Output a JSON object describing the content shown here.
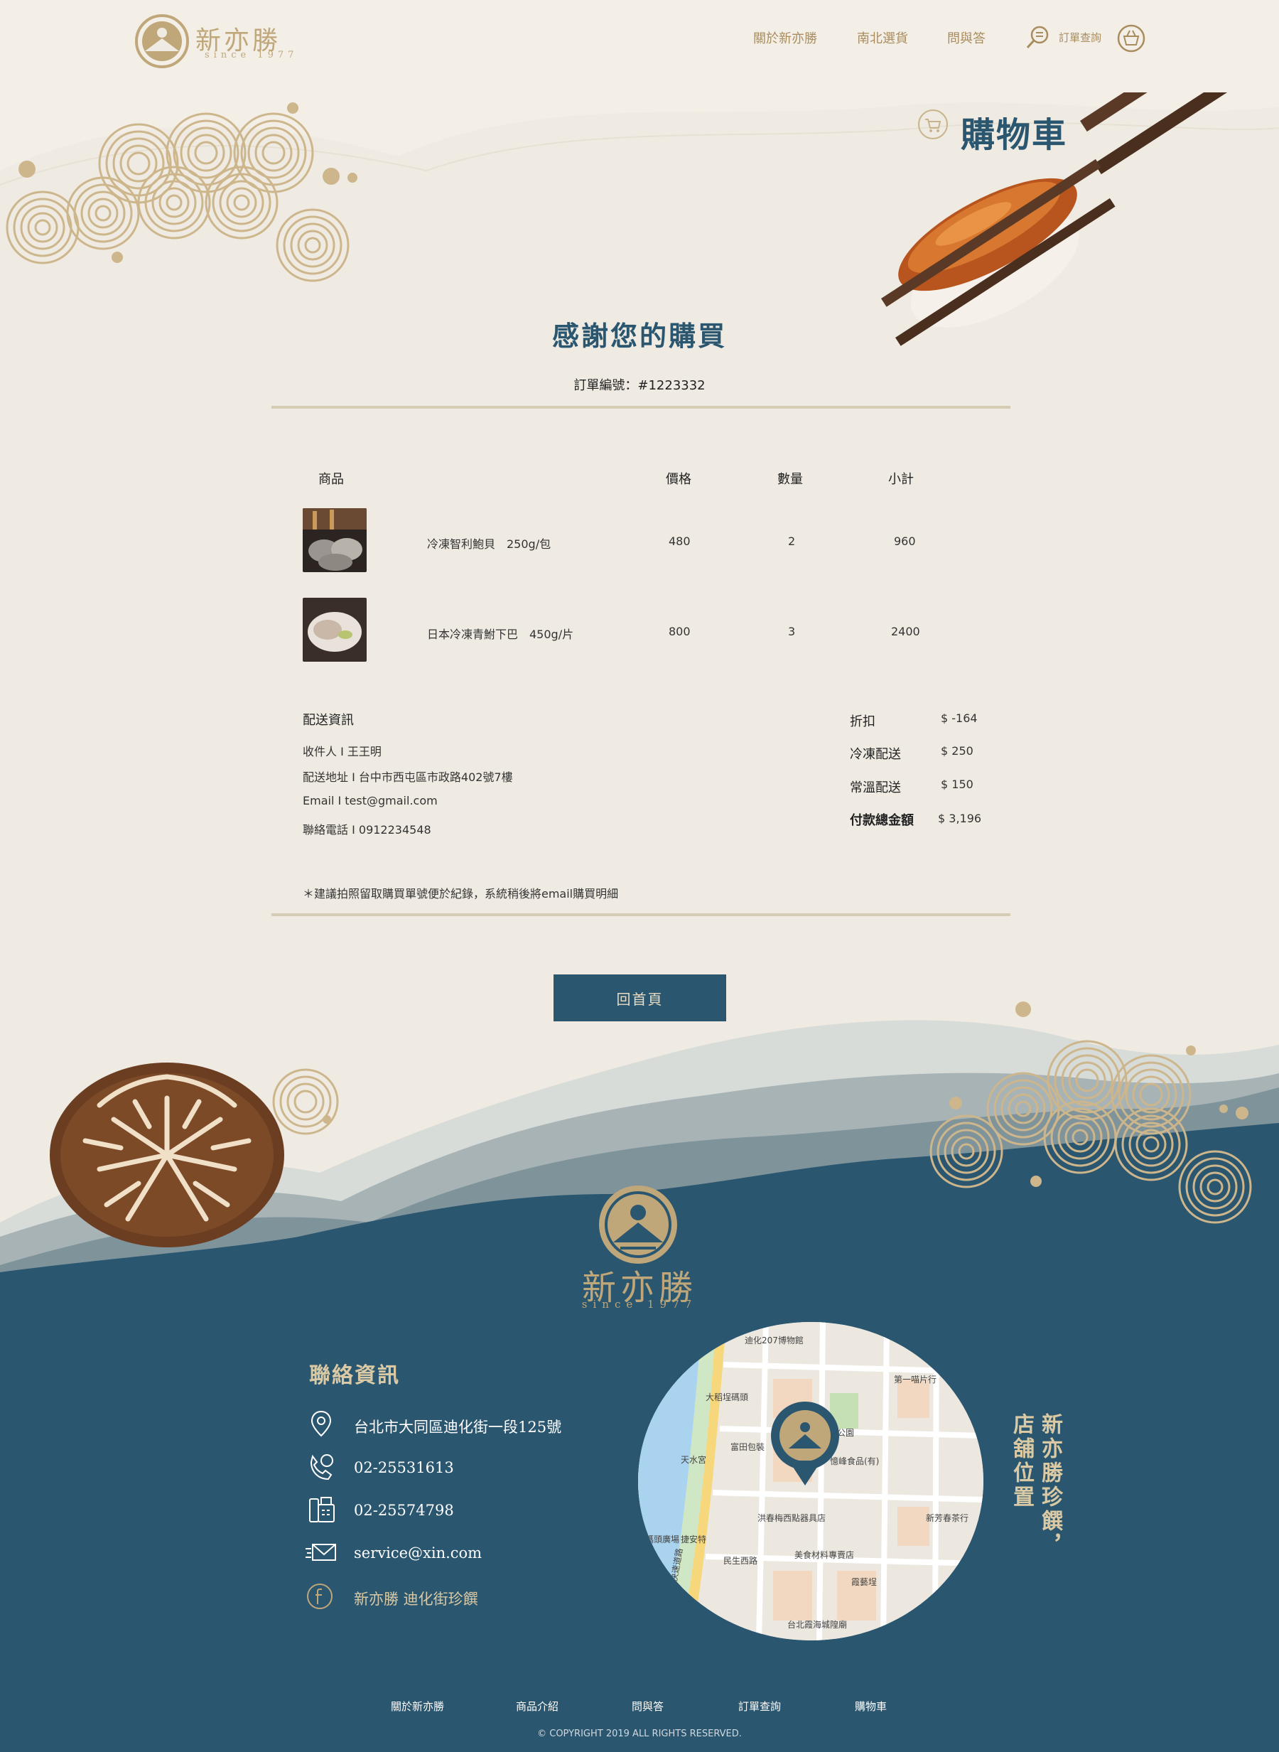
{
  "header": {
    "logo_text": "新亦勝",
    "logo_since": "since 1977",
    "nav": [
      "關於新亦勝",
      "南北選貨",
      "問與答"
    ],
    "order_lookup": "訂單查詢"
  },
  "page": {
    "title": "購物車",
    "thanks": "感謝您的購買",
    "order_no": "訂單編號：#1223332"
  },
  "table": {
    "headers": [
      "商品",
      "價格",
      "數量",
      "小計"
    ],
    "rows": [
      {
        "name": "冷凍智利鮑貝　250g/包",
        "price": "480",
        "qty": "2",
        "subtotal": "960"
      },
      {
        "name": "日本冷凍青鮒下巴　450g/片",
        "price": "800",
        "qty": "3",
        "subtotal": "2400"
      }
    ]
  },
  "shipping": {
    "title": "配送資訊",
    "recipient": "收件人 I  王王明",
    "address": "配送地址 I  台中市西屯區市政路402號7樓",
    "email": "Email I  test@gmail.com",
    "phone": "聯絡電話 I  0912234548"
  },
  "summary": {
    "discount_label": "折扣",
    "discount_value": "$ -164",
    "frozen_label": "冷凍配送",
    "frozen_value": "$  250",
    "ambient_label": "常溫配送",
    "ambient_value": "$  150",
    "total_label": "付款總金額",
    "total_value": "$ 3,196"
  },
  "note": "＊建議拍照留取購買單號便於紀錄，系統稍後將email購買明細",
  "home_button": "回首頁",
  "footer": {
    "logo_text": "新亦勝",
    "logo_since": "since 1977",
    "contact_title": "聯絡資訊",
    "address": "台北市大同區迪化街一段125號",
    "phone": "02-25531613",
    "fax": "02-25574798",
    "email": "service@xin.com",
    "facebook": "新亦勝 迪化街珍饌",
    "vertical_1": "新亦勝珍饌，",
    "vertical_2": "店舖位置",
    "map_labels": {
      "museum": "迪化207博物館",
      "dadaocheng": "大稻埕碼頭",
      "tianshui": "天水宮",
      "fufu": "富田包裝",
      "first": "第一喵片行",
      "snack": "憶峰食品(有)",
      "park": "公園",
      "hongchun": "洪春梅西點器具店",
      "minsheng": "民生西路",
      "meishi": "美食材料專賣店",
      "xinfang": "新芳春茶行",
      "chengtian": "霞藝埕",
      "mazu": "台北霞海城隍廟",
      "expressway": "環河快速道路",
      "jieanTe": "捷安特",
      "matou": "碼頭廣場"
    },
    "footer_nav": [
      "關於新亦勝",
      "商品介紹",
      "問與答",
      "訂單查詢",
      "購物車"
    ],
    "copyright": "© COPYRIGHT 2019 ALL RIGHTS RESERVED."
  },
  "colors": {
    "navy": "#2b566f",
    "gold": "#bfa77a",
    "paper": "#efebe2"
  }
}
